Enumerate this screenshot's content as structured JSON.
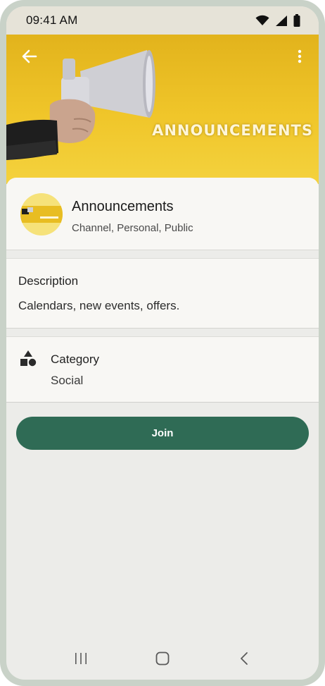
{
  "status_bar": {
    "time": "09:41 AM",
    "icons": [
      "wifi-icon",
      "signal-icon",
      "battery-icon"
    ]
  },
  "hero": {
    "banner_text": "ANNOUNCEMENTS",
    "icons": {
      "back": "arrow-left-icon",
      "more": "more-vertical-icon"
    }
  },
  "channel": {
    "name": "Announcements",
    "meta": "Channel, Personal, Public"
  },
  "description": {
    "heading": "Description",
    "text": "Calendars, new events, offers."
  },
  "category": {
    "heading": "Category",
    "value": "Social",
    "icon": "shapes-icon"
  },
  "actions": {
    "join_label": "Join"
  },
  "navigation": {
    "icons": [
      "recent-apps-icon",
      "home-icon",
      "back-icon"
    ]
  },
  "colors": {
    "accent": "#2f6b55",
    "banner": "#f0c62a",
    "background": "#ecece9",
    "surface": "#f8f7f4"
  }
}
